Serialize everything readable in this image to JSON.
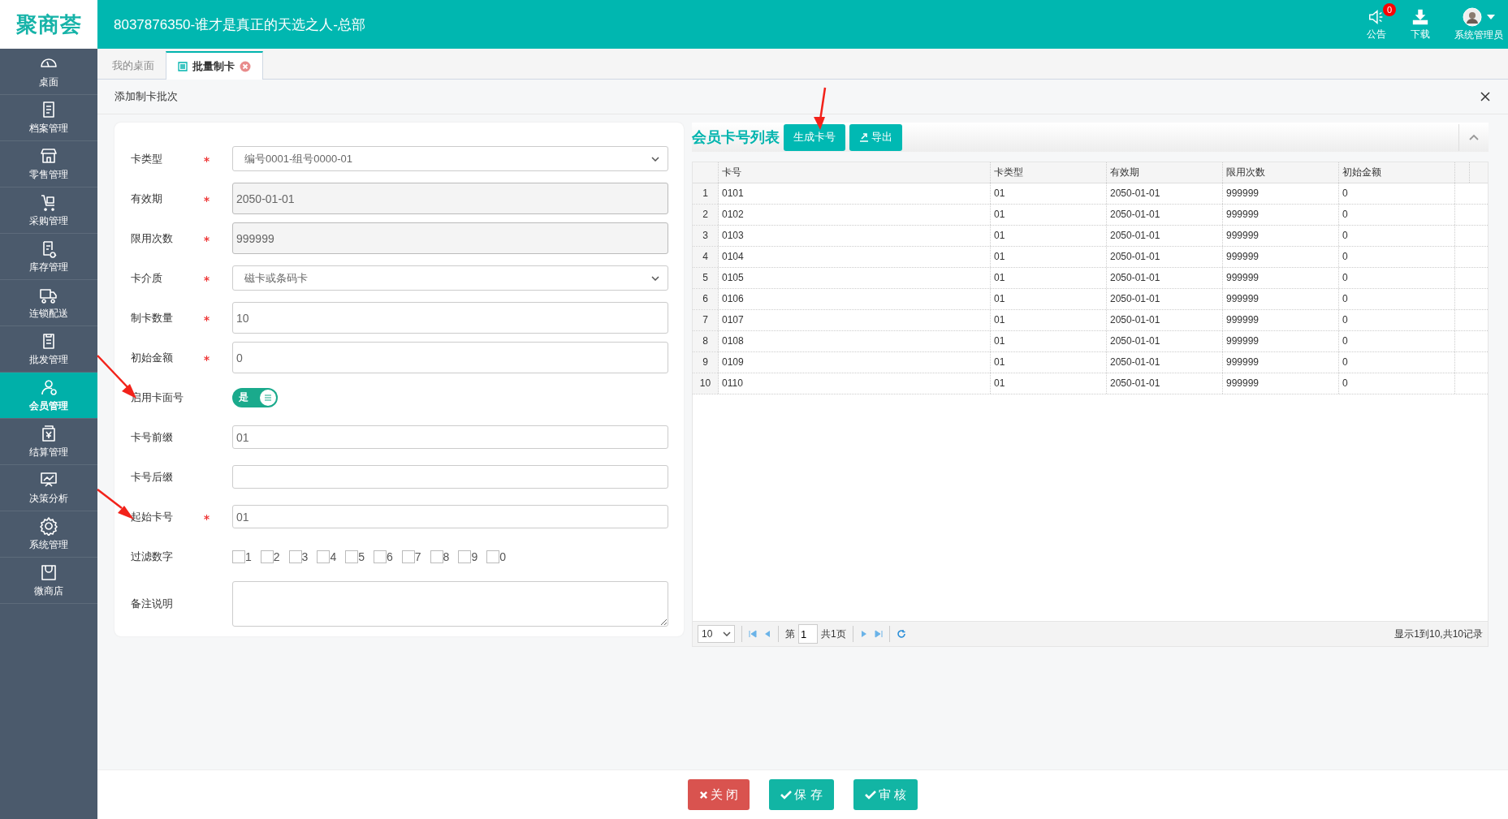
{
  "header": {
    "logo": "聚商荟",
    "title": "8037876350-谁才是真正的天选之人-总部",
    "notice": {
      "label": "公告",
      "badge": "0"
    },
    "download": {
      "label": "下载"
    },
    "user": {
      "label": "系统管理员"
    }
  },
  "sidebar": {
    "items": [
      {
        "label": "桌面",
        "selected": false
      },
      {
        "label": "档案管理",
        "selected": false
      },
      {
        "label": "零售管理",
        "selected": false
      },
      {
        "label": "采购管理",
        "selected": false
      },
      {
        "label": "库存管理",
        "selected": false
      },
      {
        "label": "连锁配送",
        "selected": false
      },
      {
        "label": "批发管理",
        "selected": false
      },
      {
        "label": "会员管理",
        "selected": true
      },
      {
        "label": "结算管理",
        "selected": false
      },
      {
        "label": "决策分析",
        "selected": false
      },
      {
        "label": "系统管理",
        "selected": false
      },
      {
        "label": "微商店",
        "selected": false
      }
    ]
  },
  "tabs": [
    {
      "label": "我的桌面",
      "selected": false,
      "closable": false
    },
    {
      "label": "批量制卡",
      "selected": true,
      "closable": true
    }
  ],
  "dialog": {
    "title": "添加制卡批次"
  },
  "form": {
    "fields": [
      {
        "kind": "select",
        "label": "卡类型",
        "required": true,
        "value": "编号0001-组号0000-01"
      },
      {
        "kind": "input",
        "label": "有效期",
        "required": true,
        "value": "2050-01-01",
        "disabled": true
      },
      {
        "kind": "input",
        "label": "限用次数",
        "required": true,
        "value": "999999",
        "disabled": true
      },
      {
        "kind": "select",
        "label": "卡介质",
        "required": true,
        "value": "磁卡或条码卡"
      },
      {
        "kind": "input",
        "label": "制卡数量",
        "required": true,
        "value": "10",
        "disabled": false
      },
      {
        "kind": "input",
        "label": "初始金额",
        "required": true,
        "value": "0",
        "disabled": false
      },
      {
        "kind": "toggle",
        "label": "启用卡面号",
        "required": false,
        "on": true,
        "text": "是"
      },
      {
        "kind": "input",
        "label": "卡号前缀",
        "required": false,
        "value": "01",
        "disabled": false
      },
      {
        "kind": "input",
        "label": "卡号后缀",
        "required": false,
        "disabled": false
      },
      {
        "kind": "input",
        "label": "起始卡号",
        "required": true,
        "value": "01",
        "disabled": false
      },
      {
        "kind": "checkboxes",
        "label": "过滤数字",
        "required": false,
        "options": [
          {
            "label": "1",
            "checked": false
          },
          {
            "label": "2",
            "checked": false
          },
          {
            "label": "3",
            "checked": false
          },
          {
            "label": "4",
            "checked": false
          },
          {
            "label": "5",
            "checked": false
          },
          {
            "label": "6",
            "checked": false
          },
          {
            "label": "7",
            "checked": false
          },
          {
            "label": "8",
            "checked": false
          },
          {
            "label": "9",
            "checked": false
          },
          {
            "label": "0",
            "checked": false
          }
        ]
      },
      {
        "kind": "textarea",
        "label": "备注说明",
        "required": false
      }
    ]
  },
  "card_list": {
    "title": "会员卡号列表",
    "buttons": [
      {
        "label": "生成卡号",
        "kind": "plain"
      },
      {
        "label": "导出",
        "kind": "export"
      }
    ],
    "table": {
      "columns": [
        "卡号",
        "卡类型",
        "有效期",
        "限用次数",
        "初始金额"
      ],
      "rows": [
        {
          "index": "1",
          "cells": [
            "0101",
            "01",
            "2050-01-01",
            "999999",
            "0"
          ]
        },
        {
          "index": "2",
          "cells": [
            "0102",
            "01",
            "2050-01-01",
            "999999",
            "0"
          ]
        },
        {
          "index": "3",
          "cells": [
            "0103",
            "01",
            "2050-01-01",
            "999999",
            "0"
          ]
        },
        {
          "index": "4",
          "cells": [
            "0104",
            "01",
            "2050-01-01",
            "999999",
            "0"
          ]
        },
        {
          "index": "5",
          "cells": [
            "0105",
            "01",
            "2050-01-01",
            "999999",
            "0"
          ]
        },
        {
          "index": "6",
          "cells": [
            "0106",
            "01",
            "2050-01-01",
            "999999",
            "0"
          ]
        },
        {
          "index": "7",
          "cells": [
            "0107",
            "01",
            "2050-01-01",
            "999999",
            "0"
          ]
        },
        {
          "index": "8",
          "cells": [
            "0108",
            "01",
            "2050-01-01",
            "999999",
            "0"
          ]
        },
        {
          "index": "9",
          "cells": [
            "0109",
            "01",
            "2050-01-01",
            "999999",
            "0"
          ]
        },
        {
          "index": "10",
          "cells": [
            "0110",
            "01",
            "2050-01-01",
            "999999",
            "0"
          ]
        }
      ]
    },
    "pager": {
      "page_size": "10",
      "page_prefix": "第",
      "page": "1",
      "page_total": "共1页",
      "summary": "显示1到10,共10记录"
    }
  },
  "footer": {
    "buttons": [
      {
        "label": "关 闭",
        "kind": "close"
      },
      {
        "label": "保 存",
        "kind": "save"
      },
      {
        "label": "审 核",
        "kind": "approve"
      }
    ]
  }
}
